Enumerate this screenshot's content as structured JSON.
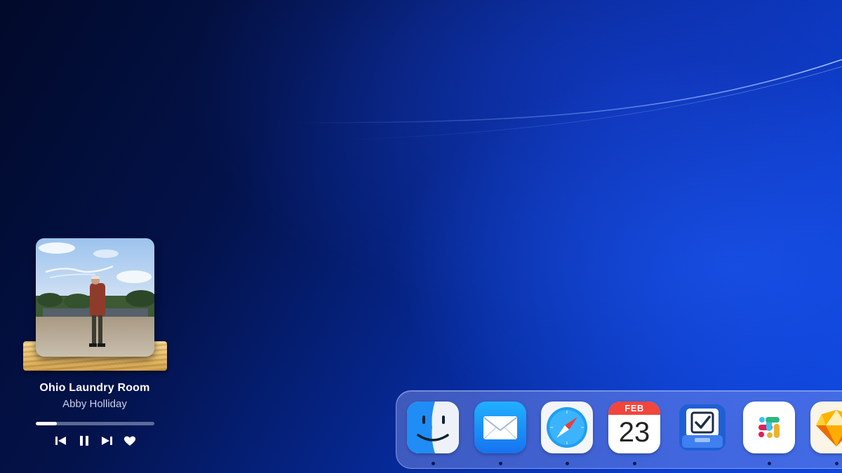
{
  "now_playing": {
    "title": "Ohio Laundry Room",
    "artist": "Abby Holliday",
    "progress": 0.18,
    "controls": [
      "previous-icon",
      "pause-icon",
      "next-icon",
      "heart-icon"
    ]
  },
  "dock": {
    "items": [
      {
        "name": "Finder",
        "icon": "finder-icon",
        "running": true
      },
      {
        "name": "Mail",
        "icon": "mail-icon",
        "running": true
      },
      {
        "name": "Safari",
        "icon": "safari-icon",
        "running": true
      },
      {
        "name": "Calendar",
        "icon": "calendar-icon",
        "running": true,
        "month": "FEB",
        "day": "23"
      },
      {
        "name": "OmniFocus",
        "icon": "checkbox-tray-icon",
        "running": false
      },
      {
        "name": "Slack",
        "icon": "slack-icon",
        "running": true
      },
      {
        "name": "Sketch",
        "icon": "sketch-diamond-icon",
        "running": true
      }
    ]
  },
  "colors": {
    "wallpaper_dark": "#020a2a",
    "wallpaper_bright": "#0d46dc",
    "accent_white": "#ffffff"
  }
}
